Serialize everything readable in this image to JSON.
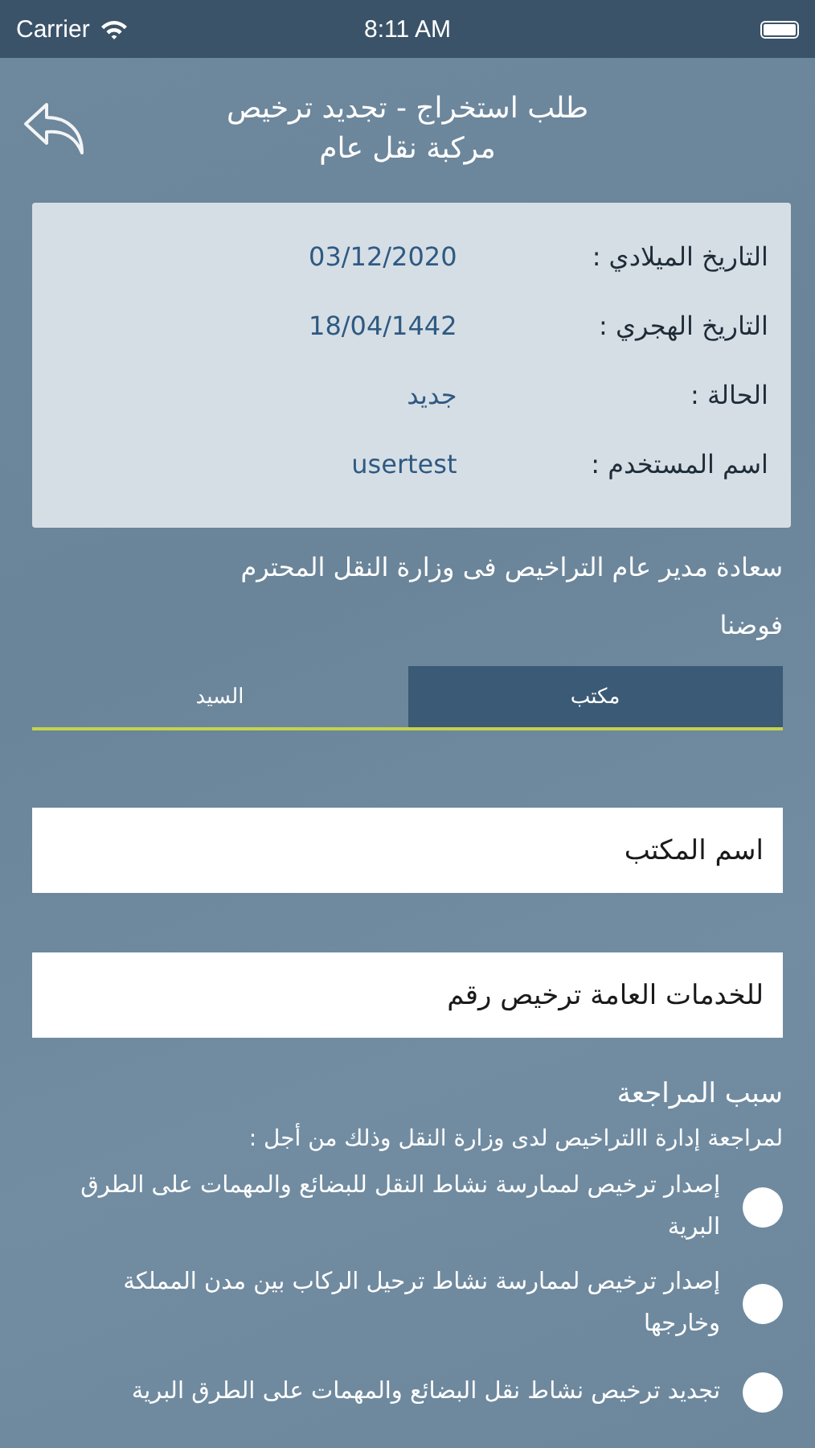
{
  "status_bar": {
    "carrier": "Carrier",
    "time": "8:11 AM"
  },
  "header": {
    "title_lines": [
      "طلب استخراج - تجديد ترخيص",
      "مركبة نقل عام"
    ]
  },
  "info_card": {
    "rows": [
      {
        "label": "التاريخ الميلادي :",
        "value": "03/12/2020"
      },
      {
        "label": "التاريخ الهجري :",
        "value": "18/04/1442"
      },
      {
        "label": "الحالة :",
        "value": "جديد"
      },
      {
        "label": "اسم المستخدم :",
        "value": "usertest"
      }
    ]
  },
  "letter": {
    "greeting": "سعادة مدير عام التراخيص فى وزارة النقل المحترم",
    "mandate": "فوضنا"
  },
  "tabs": [
    {
      "label": "مكتب",
      "selected": true
    },
    {
      "label": "السيد",
      "selected": false
    }
  ],
  "fields": [
    {
      "placeholder": "اسم المكتب"
    },
    {
      "placeholder": "للخدمات العامة ترخيص رقم"
    }
  ],
  "reason": {
    "title": "سبب المراجعة",
    "intro": "لمراجعة إدارة االتراخيص لدى وزارة النقل وذلك من أجل :",
    "options": [
      {
        "label": "إصدار ترخيص لممارسة نشاط النقل للبضائع والمهمات على الطرق البرية",
        "selected": false
      },
      {
        "label": "إصدار ترخيص لممارسة نشاط ترحيل الركاب بين مدن المملكة وخارجها",
        "selected": false
      },
      {
        "label": "تجديد ترخيص نشاط نقل البضائع والمهمات على الطرق البرية",
        "selected": false
      }
    ]
  }
}
